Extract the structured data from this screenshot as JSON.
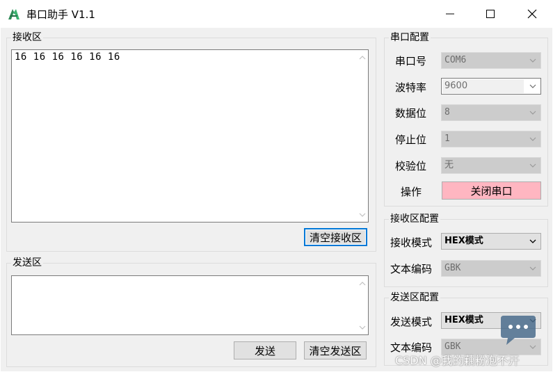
{
  "window": {
    "title": "串口助手 V1.1",
    "minimize": "–",
    "maximize": "□",
    "close": "×"
  },
  "receive": {
    "group_title": "接收区",
    "content": "16 16 16 16 16 16",
    "clear_button": "清空接收区"
  },
  "send": {
    "group_title": "发送区",
    "content": "",
    "send_button": "发送",
    "clear_button": "清空发送区"
  },
  "serial_config": {
    "group_title": "串口配置",
    "port_label": "串口号",
    "port_value": "COM6",
    "baud_label": "波特率",
    "baud_value": "9600",
    "data_bits_label": "数据位",
    "data_bits_value": "8",
    "stop_bits_label": "停止位",
    "stop_bits_value": "1",
    "parity_label": "校验位",
    "parity_value": "无",
    "operation_label": "操作",
    "operation_button": "关闭串口"
  },
  "receive_config": {
    "group_title": "接收区配置",
    "mode_label": "接收模式",
    "mode_value": "HEX模式",
    "encoding_label": "文本编码",
    "encoding_value": "GBK"
  },
  "send_config": {
    "group_title": "发送区配置",
    "mode_label": "发送模式",
    "mode_value": "HEX模式",
    "encoding_label": "文本编码",
    "encoding_value": "GBK"
  },
  "watermark": "CSDN @我的藕粉泡不开",
  "colors": {
    "window_bg": "#f0f0f0",
    "accent_border": "#0078d7",
    "close_port_button": "#ffb6c1",
    "disabled_combo": "#cccccc"
  }
}
